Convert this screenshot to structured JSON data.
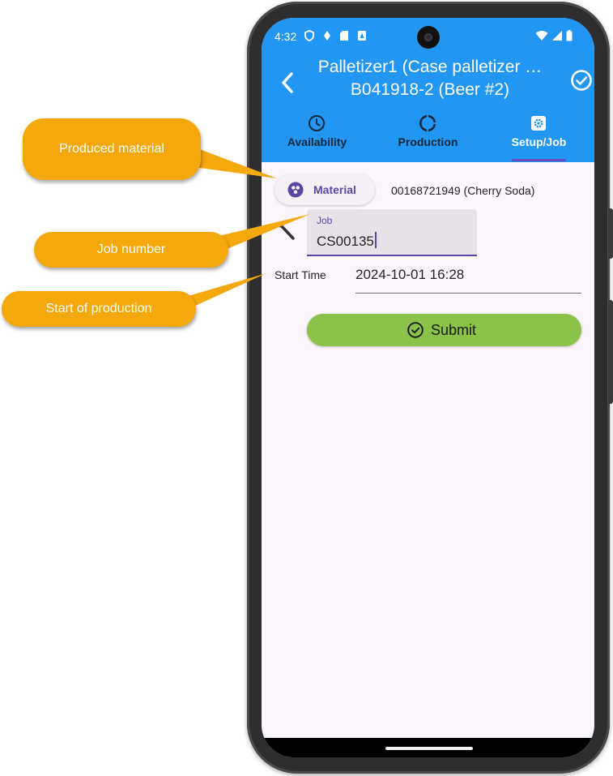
{
  "status_bar": {
    "time": "4:32"
  },
  "app_bar": {
    "title_line1": "Palletizer1 (Case palletizer …",
    "title_line2": "B041918-2 (Beer #2)",
    "back_icon": "chevron-left-icon",
    "confirm_icon": "check-circle-icon",
    "background_color": "#2196f3"
  },
  "tabs": [
    {
      "label": "Availability",
      "icon": "clock-icon",
      "active": false
    },
    {
      "label": "Production",
      "icon": "progress-ring-icon",
      "active": false
    },
    {
      "label": "Setup/Job",
      "icon": "settings-icon",
      "active": true
    }
  ],
  "material": {
    "chip_label": "Material",
    "chip_icon": "material-dots-icon",
    "value": "00168721949 (Cherry Soda)"
  },
  "job": {
    "label": "Job",
    "value": "CS00135"
  },
  "start_time": {
    "label": "Start Time",
    "value": "2024-10-01 16:28"
  },
  "submit": {
    "label": "Submit",
    "icon": "check-circle-icon",
    "color": "#8bc34a"
  },
  "callouts": [
    {
      "text": "Produced material"
    },
    {
      "text": "Job number"
    },
    {
      "text": "Start of production"
    }
  ],
  "callout_color": "#f5a80b"
}
